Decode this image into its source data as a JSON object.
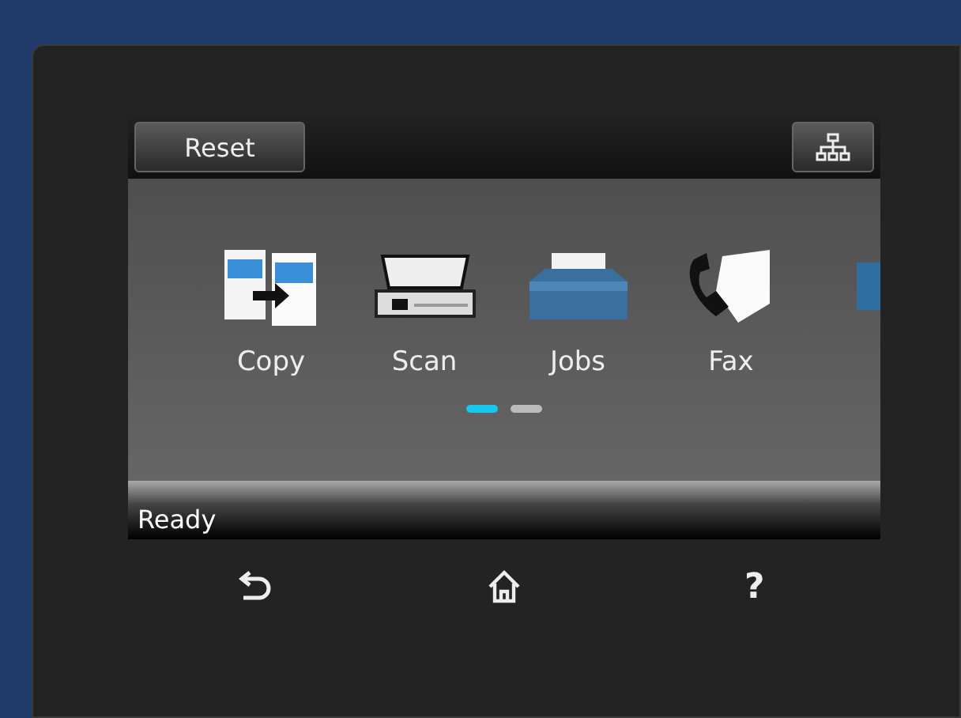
{
  "top_bar": {
    "reset_button": "Reset"
  },
  "apps": [
    {
      "kind": "copy",
      "label": "Copy"
    },
    {
      "kind": "scan",
      "label": "Scan"
    },
    {
      "kind": "jobs",
      "label": "Jobs"
    },
    {
      "kind": "fax",
      "label": "Fax"
    },
    {
      "kind": "folder"
    }
  ],
  "pages": [
    {
      "selected": true
    },
    {
      "selected": false
    }
  ],
  "status_bar": {
    "text": "Ready"
  },
  "nav": {
    "help": "?"
  }
}
